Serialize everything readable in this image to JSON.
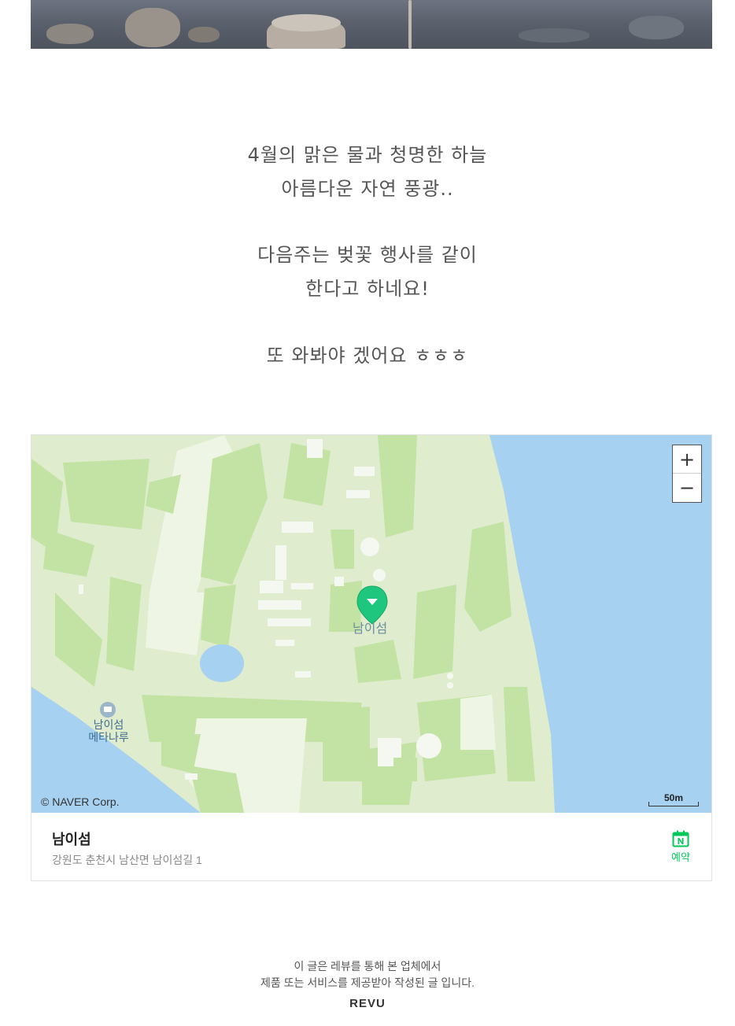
{
  "photo": {
    "icon": "lake-photo"
  },
  "poem": {
    "stanza1": [
      "4월의 맑은 물과 청명한 하늘",
      "아름다운 자연 풍광.."
    ],
    "stanza2": [
      "다음주는 벚꽃 행사를 같이",
      "한다고 하네요!"
    ],
    "stanza3": [
      "또 와봐야 겠어요 ㅎㅎㅎ"
    ]
  },
  "map": {
    "zoom_in_label": "+",
    "zoom_out_label": "−",
    "copyright": "© NAVER Corp.",
    "scale_label": "50m",
    "pin_label": "남이섬",
    "poi_label_line1": "남이섬",
    "poi_label_line2": "메타나루",
    "colors": {
      "water": "#a6d1f0",
      "land": "#dfeccd",
      "green": "#c2e3a4",
      "pin": "#1fc77e"
    }
  },
  "place": {
    "name": "남이섬",
    "address": "강원도 춘천시 남산면 남이섬길 1",
    "reserve_label": "예약",
    "reserve_icon": "naver-calendar-icon"
  },
  "footer": {
    "line1": "이 글은 레뷰를 통해 본 업체에서",
    "line2": "제품 또는 서비스를 제공받아 작성된 글 입니다.",
    "brand": "REVU"
  }
}
